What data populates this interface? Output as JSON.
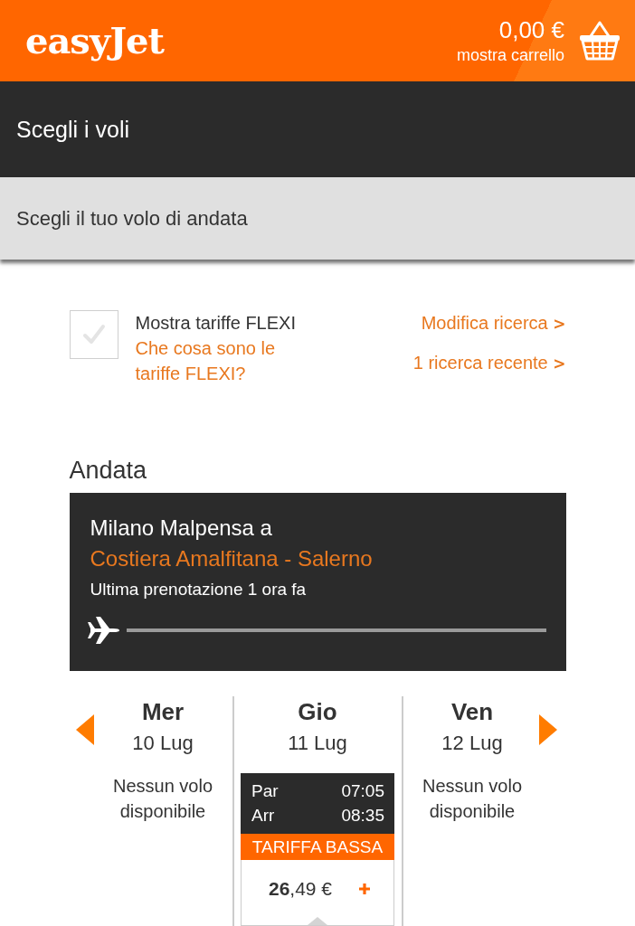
{
  "header": {
    "logo": "easyJet",
    "cart_total": "0,00 €",
    "cart_link": "mostra carrello"
  },
  "title_bar": {
    "title": "Scegli i voli"
  },
  "subtitle_bar": {
    "title": "Scegli il tuo volo di andata"
  },
  "options": {
    "flexi": {
      "label": "Mostra tariffe FLEXI",
      "checked": false
    },
    "info_link": "Che cosa sono le tariffe FLEXI?",
    "links": [
      "Modifica ricerca **>**",
      "1 ricerca recente **>**"
    ]
  },
  "outbound": {
    "heading": "Andata",
    "route": {
      "origin": "Milano Malpensa a",
      "destination": "Costiera Amalfitana - Salerno",
      "last_booking": "Ultima prenotazione 1 ora fa"
    },
    "days": [
      {
        "day": "Mer",
        "date": "10 Lug",
        "selected": false,
        "kind": "empty",
        "message": "Nessun volo disponibile"
      },
      {
        "day": "Gio",
        "date": "11 Lug",
        "selected": true,
        "kind": "flights",
        "flights": [
          {
            "departure_label": "Par",
            "departure_time": "07:05",
            "arrival_label": "Arr",
            "arrival_time": "08:35",
            "fare": "TARIFFA BASSA",
            "price": "**26**,49 €"
          }
        ]
      },
      {
        "day": "Ven",
        "date": "12 Lug",
        "selected": false,
        "kind": "empty",
        "message": "Nessun volo disponibile"
      }
    ]
  }
}
